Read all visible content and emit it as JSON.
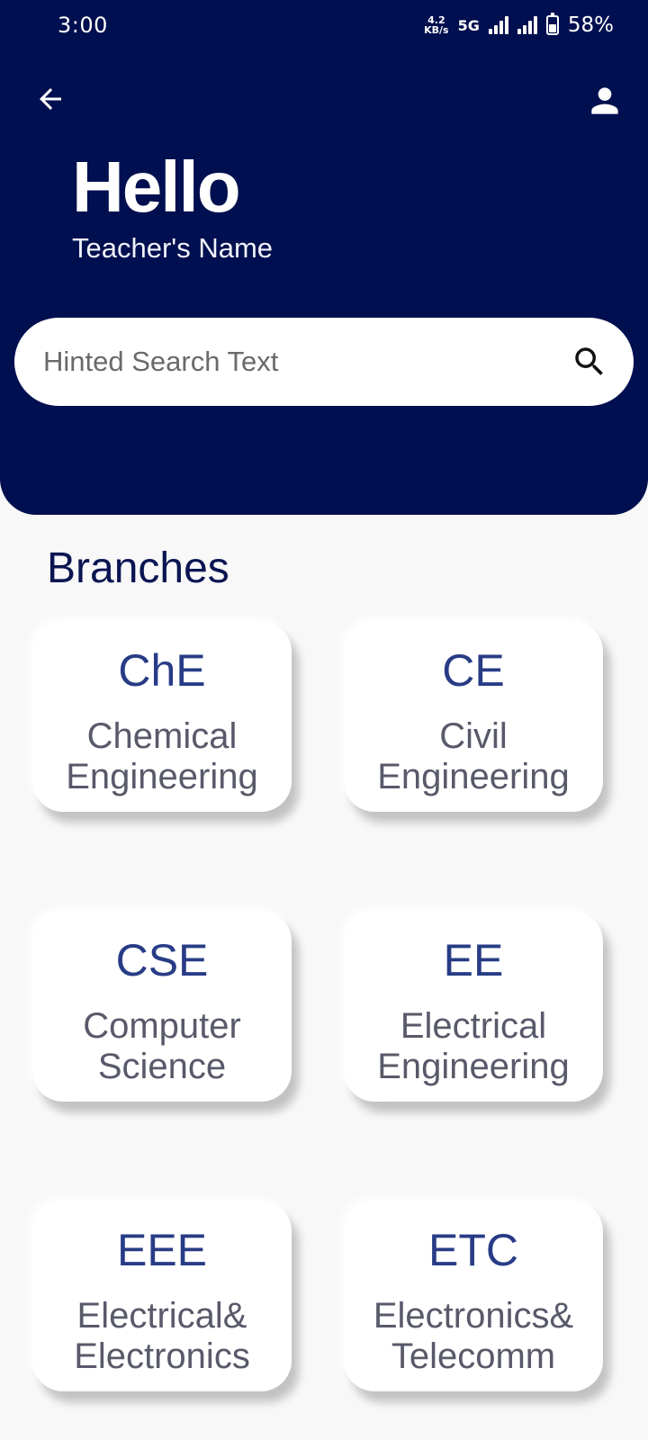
{
  "status_bar": {
    "time": "3:00",
    "net_speed_value": "4.2",
    "net_speed_unit": "KB/s",
    "network_type": "5G",
    "battery": "58%",
    "battery_level": 0.58
  },
  "header": {
    "back_icon": "arrow-left-icon",
    "profile_icon": "person-icon",
    "greeting": "Hello",
    "subtitle": "Teacher's Name",
    "background_color": "#000f4f"
  },
  "search": {
    "placeholder": "Hinted Search Text",
    "value": "",
    "icon": "search-icon"
  },
  "branches": {
    "title": "Branches",
    "items": [
      {
        "code": "ChE",
        "line1": "Chemical",
        "line2": "Engineering"
      },
      {
        "code": "CE",
        "line1": "Civil",
        "line2": "Engineering"
      },
      {
        "code": "CSE",
        "line1": "Computer",
        "line2": "Science"
      },
      {
        "code": "EE",
        "line1": "Electrical",
        "line2": "Engineering"
      },
      {
        "code": "EEE",
        "line1": "Electrical&",
        "line2": "Electronics"
      },
      {
        "code": "ETC",
        "line1": "Electronics&",
        "line2": "Telecomm"
      }
    ]
  }
}
